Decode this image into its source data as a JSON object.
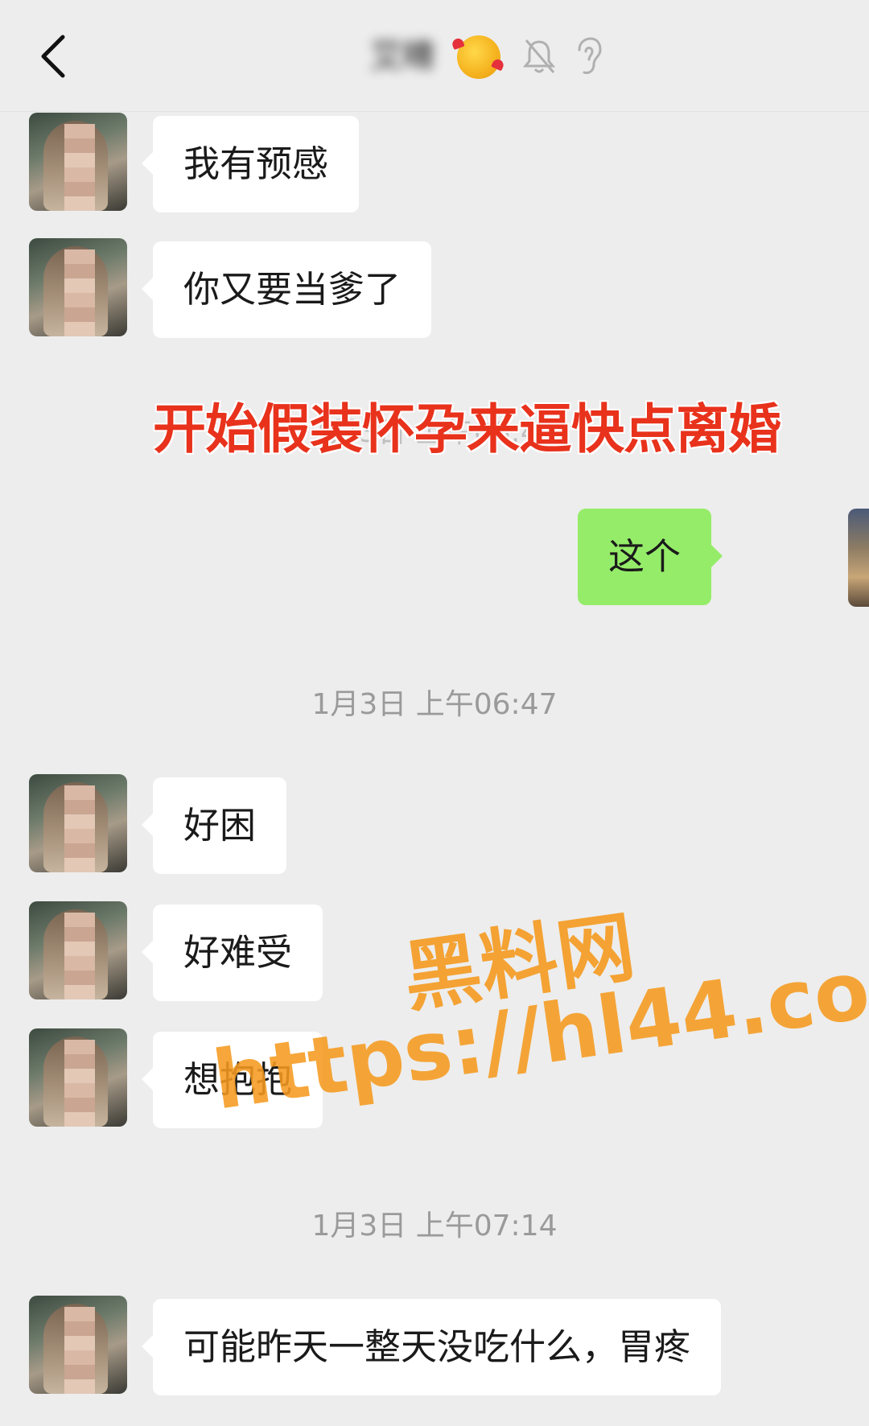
{
  "header": {
    "title": "艾晴",
    "back_icon": "chevron-left-icon",
    "mute_icon": "bell-muted-icon",
    "ear_icon": "ear-icon",
    "emoji": "smiling-face-with-hearts"
  },
  "messages": [
    {
      "sender": "contact",
      "text": "我有预感"
    },
    {
      "sender": "contact",
      "text": "你又要当爹了"
    },
    {
      "sender": "me",
      "text": "这个"
    },
    {
      "sender": "contact",
      "text": "好困"
    },
    {
      "sender": "contact",
      "text": "好难受"
    },
    {
      "sender": "contact",
      "text": "想抱抱"
    },
    {
      "sender": "contact",
      "text": "可能昨天一整天没吃什么，胃疼"
    }
  ],
  "timestamps": {
    "obscured": "1月3日 上午06:45",
    "t1": "1月3日 上午06:47",
    "t2": "1月3日 上午07:14"
  },
  "annotation": "开始假装怀孕来逼快点离婚",
  "watermark": {
    "line1": "黑料网",
    "line2": "https://hl44.co"
  },
  "colors": {
    "background": "#ededed",
    "contact_bubble": "#ffffff",
    "my_bubble": "#95ec69",
    "annotation": "#e8321c",
    "watermark": "#f59a1f"
  }
}
